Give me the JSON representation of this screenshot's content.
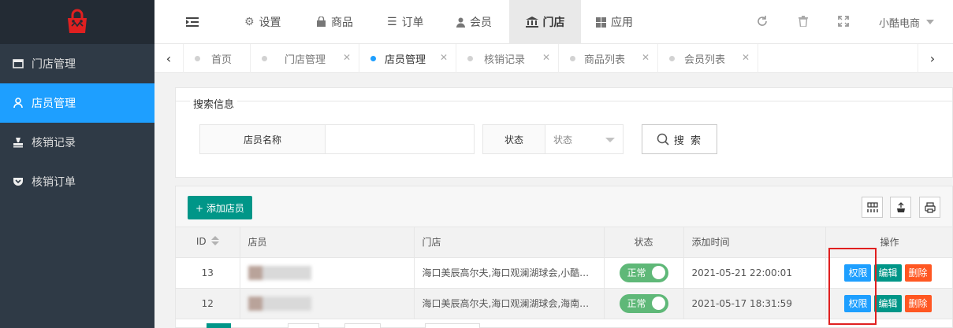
{
  "sidebar": {
    "logo_icon": "shopping-bag-icon",
    "items": [
      {
        "label": "门店管理",
        "icon": "window-icon",
        "active": false
      },
      {
        "label": "店员管理",
        "icon": "user-icon",
        "active": true
      },
      {
        "label": "核销记录",
        "icon": "stamp-icon",
        "active": false
      },
      {
        "label": "核销订单",
        "icon": "pocket-icon",
        "active": false
      }
    ]
  },
  "header": {
    "nav": [
      {
        "label": "设置",
        "icon": "gears-icon"
      },
      {
        "label": "商品",
        "icon": "bag-icon"
      },
      {
        "label": "订单",
        "icon": "list-icon"
      },
      {
        "label": "会员",
        "icon": "person-icon"
      },
      {
        "label": "门店",
        "icon": "bank-icon",
        "active": true
      },
      {
        "label": "应用",
        "icon": "grid-icon"
      }
    ],
    "user": "小酷电商"
  },
  "tabs": [
    {
      "label": "首页",
      "closable": false
    },
    {
      "label": "门店管理",
      "closable": true
    },
    {
      "label": "店员管理",
      "closable": true,
      "active": true
    },
    {
      "label": "核销记录",
      "closable": true
    },
    {
      "label": "商品列表",
      "closable": true
    },
    {
      "label": "会员列表",
      "closable": true
    }
  ],
  "search": {
    "legend": "搜索信息",
    "name_label": "店员名称",
    "name_value": "",
    "status_label": "状态",
    "status_placeholder": "状态",
    "button": "搜 索"
  },
  "table": {
    "add_button": "+ 添加店员",
    "columns": [
      "ID",
      "店员",
      "门店",
      "状态",
      "添加时间",
      "操作"
    ],
    "rows": [
      {
        "id": "13",
        "store": "海口美辰高尔夫,海口观澜湖球会,小酷…",
        "status": "正常",
        "time": "2021-05-21 22:00:01"
      },
      {
        "id": "12",
        "store": "海口美辰高尔夫,海口观澜湖球会,海南…",
        "status": "正常",
        "time": "2021-05-17 18:31:59"
      }
    ],
    "ops": {
      "perm": "权限",
      "edit": "编辑",
      "delete": "删除"
    }
  },
  "colors": {
    "accent": "#1e9fff",
    "teal": "#009688",
    "danger": "#ff5722",
    "switch_on": "#5fb878"
  }
}
